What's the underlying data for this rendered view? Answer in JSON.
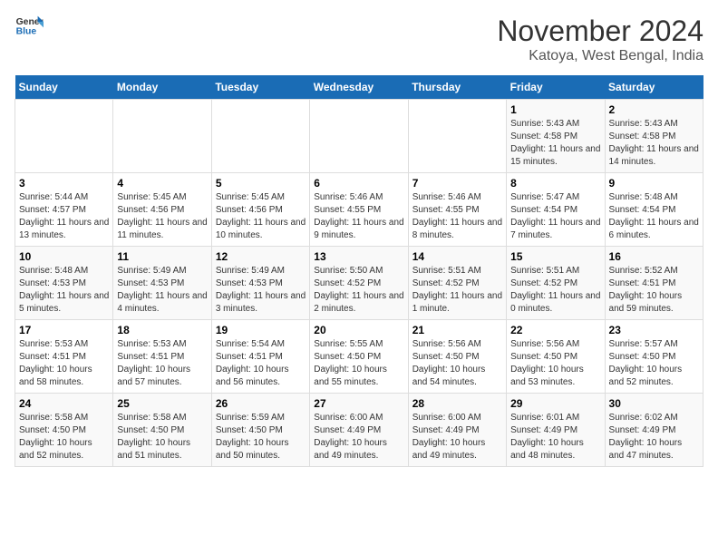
{
  "logo": {
    "line1": "General",
    "line2": "Blue"
  },
  "title": "November 2024",
  "location": "Katoya, West Bengal, India",
  "weekdays": [
    "Sunday",
    "Monday",
    "Tuesday",
    "Wednesday",
    "Thursday",
    "Friday",
    "Saturday"
  ],
  "weeks": [
    [
      {
        "day": "",
        "info": ""
      },
      {
        "day": "",
        "info": ""
      },
      {
        "day": "",
        "info": ""
      },
      {
        "day": "",
        "info": ""
      },
      {
        "day": "",
        "info": ""
      },
      {
        "day": "1",
        "info": "Sunrise: 5:43 AM\nSunset: 4:58 PM\nDaylight: 11 hours and 15 minutes."
      },
      {
        "day": "2",
        "info": "Sunrise: 5:43 AM\nSunset: 4:58 PM\nDaylight: 11 hours and 14 minutes."
      }
    ],
    [
      {
        "day": "3",
        "info": "Sunrise: 5:44 AM\nSunset: 4:57 PM\nDaylight: 11 hours and 13 minutes."
      },
      {
        "day": "4",
        "info": "Sunrise: 5:45 AM\nSunset: 4:56 PM\nDaylight: 11 hours and 11 minutes."
      },
      {
        "day": "5",
        "info": "Sunrise: 5:45 AM\nSunset: 4:56 PM\nDaylight: 11 hours and 10 minutes."
      },
      {
        "day": "6",
        "info": "Sunrise: 5:46 AM\nSunset: 4:55 PM\nDaylight: 11 hours and 9 minutes."
      },
      {
        "day": "7",
        "info": "Sunrise: 5:46 AM\nSunset: 4:55 PM\nDaylight: 11 hours and 8 minutes."
      },
      {
        "day": "8",
        "info": "Sunrise: 5:47 AM\nSunset: 4:54 PM\nDaylight: 11 hours and 7 minutes."
      },
      {
        "day": "9",
        "info": "Sunrise: 5:48 AM\nSunset: 4:54 PM\nDaylight: 11 hours and 6 minutes."
      }
    ],
    [
      {
        "day": "10",
        "info": "Sunrise: 5:48 AM\nSunset: 4:53 PM\nDaylight: 11 hours and 5 minutes."
      },
      {
        "day": "11",
        "info": "Sunrise: 5:49 AM\nSunset: 4:53 PM\nDaylight: 11 hours and 4 minutes."
      },
      {
        "day": "12",
        "info": "Sunrise: 5:49 AM\nSunset: 4:53 PM\nDaylight: 11 hours and 3 minutes."
      },
      {
        "day": "13",
        "info": "Sunrise: 5:50 AM\nSunset: 4:52 PM\nDaylight: 11 hours and 2 minutes."
      },
      {
        "day": "14",
        "info": "Sunrise: 5:51 AM\nSunset: 4:52 PM\nDaylight: 11 hours and 1 minute."
      },
      {
        "day": "15",
        "info": "Sunrise: 5:51 AM\nSunset: 4:52 PM\nDaylight: 11 hours and 0 minutes."
      },
      {
        "day": "16",
        "info": "Sunrise: 5:52 AM\nSunset: 4:51 PM\nDaylight: 10 hours and 59 minutes."
      }
    ],
    [
      {
        "day": "17",
        "info": "Sunrise: 5:53 AM\nSunset: 4:51 PM\nDaylight: 10 hours and 58 minutes."
      },
      {
        "day": "18",
        "info": "Sunrise: 5:53 AM\nSunset: 4:51 PM\nDaylight: 10 hours and 57 minutes."
      },
      {
        "day": "19",
        "info": "Sunrise: 5:54 AM\nSunset: 4:51 PM\nDaylight: 10 hours and 56 minutes."
      },
      {
        "day": "20",
        "info": "Sunrise: 5:55 AM\nSunset: 4:50 PM\nDaylight: 10 hours and 55 minutes."
      },
      {
        "day": "21",
        "info": "Sunrise: 5:56 AM\nSunset: 4:50 PM\nDaylight: 10 hours and 54 minutes."
      },
      {
        "day": "22",
        "info": "Sunrise: 5:56 AM\nSunset: 4:50 PM\nDaylight: 10 hours and 53 minutes."
      },
      {
        "day": "23",
        "info": "Sunrise: 5:57 AM\nSunset: 4:50 PM\nDaylight: 10 hours and 52 minutes."
      }
    ],
    [
      {
        "day": "24",
        "info": "Sunrise: 5:58 AM\nSunset: 4:50 PM\nDaylight: 10 hours and 52 minutes."
      },
      {
        "day": "25",
        "info": "Sunrise: 5:58 AM\nSunset: 4:50 PM\nDaylight: 10 hours and 51 minutes."
      },
      {
        "day": "26",
        "info": "Sunrise: 5:59 AM\nSunset: 4:50 PM\nDaylight: 10 hours and 50 minutes."
      },
      {
        "day": "27",
        "info": "Sunrise: 6:00 AM\nSunset: 4:49 PM\nDaylight: 10 hours and 49 minutes."
      },
      {
        "day": "28",
        "info": "Sunrise: 6:00 AM\nSunset: 4:49 PM\nDaylight: 10 hours and 49 minutes."
      },
      {
        "day": "29",
        "info": "Sunrise: 6:01 AM\nSunset: 4:49 PM\nDaylight: 10 hours and 48 minutes."
      },
      {
        "day": "30",
        "info": "Sunrise: 6:02 AM\nSunset: 4:49 PM\nDaylight: 10 hours and 47 minutes."
      }
    ]
  ]
}
